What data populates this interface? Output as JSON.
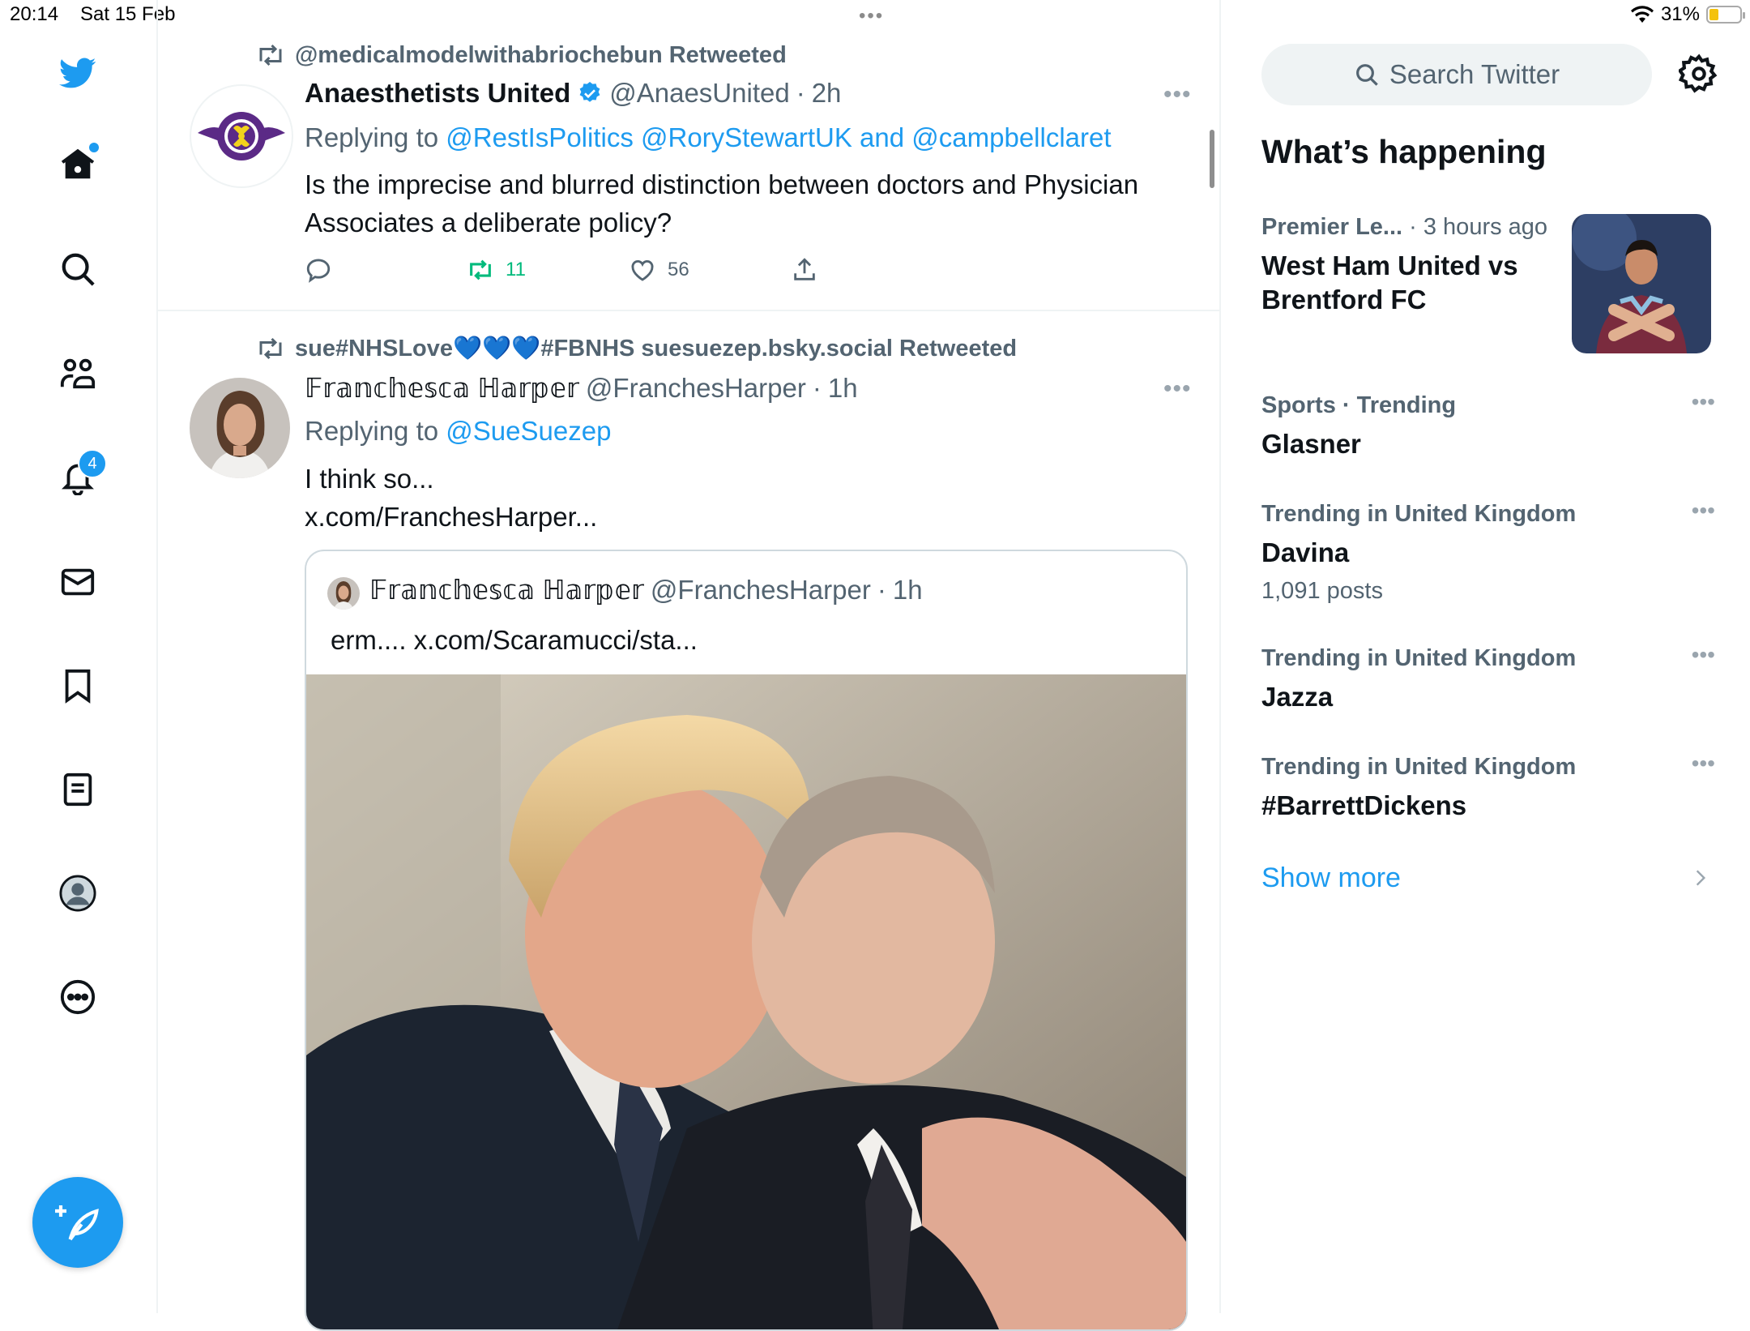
{
  "status_bar": {
    "time": "20:14",
    "date": "Sat 15 Feb",
    "battery": "31%",
    "battery_level": 0.31
  },
  "nav": {
    "items": [
      "twitter-logo",
      "home",
      "search",
      "communities",
      "notifications",
      "messages",
      "bookmarks",
      "lists",
      "profile",
      "more"
    ],
    "notifications_badge": "4"
  },
  "tweets": [
    {
      "retweeted_by": "@medicalmodelwithabriochebun Retweeted",
      "author_name": "Anaesthetists United",
      "verified": true,
      "handle": "@AnaesUnited",
      "sep": "·",
      "time": "2h",
      "replying_prefix": "Replying to",
      "replying_to": "@RestIsPolitics @RoryStewartUK and @campbellclaret",
      "text_line1": "Is the imprecise and blurred distinction between doctors and Physician",
      "text_line2": "Associates a deliberate policy?",
      "retweets": "11",
      "likes": "56"
    },
    {
      "retweeted_by": "sue#NHSLove💙💙💙#FBNHS suesuezep.bsky.social Retweeted",
      "author_name": "𝔽𝕣𝕒𝕟𝕔𝕙𝕖𝕤𝕔𝕒 ℍ𝕒𝕣𝕡𝕖𝕣",
      "handle": "@FranchesHarper",
      "sep": "·",
      "time": "1h",
      "replying_prefix": "Replying to",
      "replying_to": "@SueSuezep",
      "text_line1": "I think so...",
      "link": "x.com/FranchesHarper...",
      "quote": {
        "author_name": "𝔽𝕣𝕒𝕟𝕔𝕙𝕖𝕤𝕔𝕒 ℍ𝕒𝕣𝕡𝕖𝕣",
        "handle": "@FranchesHarper",
        "sep": "·",
        "time": "1h",
        "text": "erm.... x.com/Scaramucci/sta..."
      }
    }
  ],
  "sidebar": {
    "search_placeholder": "Search Twitter",
    "heading": "What’s happening",
    "trends": [
      {
        "meta": "Premier Le...",
        "meta2": "· 3 hours ago",
        "title": "West Ham United vs Brentford FC"
      },
      {
        "meta": "Sports · Trending",
        "title": "Glasner"
      },
      {
        "meta": "Trending in United Kingdom",
        "title": "Davina",
        "count": "1,091 posts"
      },
      {
        "meta": "Trending in United Kingdom",
        "title": "Jazza"
      },
      {
        "meta": "Trending in United Kingdom",
        "title": "#BarrettDickens"
      }
    ],
    "show_more": "Show more"
  },
  "colors": {
    "accent": "#1d9bf0",
    "muted": "#536471",
    "retweet_green": "#00ba7c",
    "divider": "#eff3f4"
  }
}
